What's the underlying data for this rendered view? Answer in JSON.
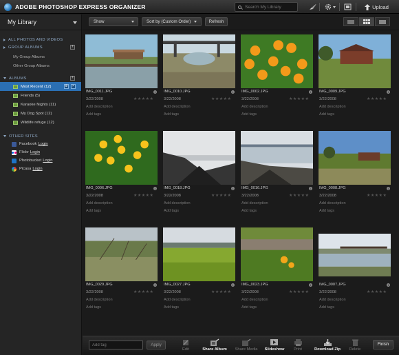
{
  "topbar": {
    "title": "ADOBE PHOTOSHOP EXPRESS ORGANIZER",
    "search_placeholder": "Search My Library",
    "upload_label": "Upload"
  },
  "sidebar": {
    "title": "My Library",
    "all_photos": "ALL PHOTOS AND VIDEOS",
    "group_albums": {
      "header": "GROUP ALBUMS",
      "items": [
        "My Group Albums",
        "Other Group Albums"
      ]
    },
    "albums": {
      "header": "ALBUMS",
      "items": [
        {
          "label": "Most Recent (12)",
          "selected": true
        },
        {
          "label": "Friends (5)",
          "selected": false
        },
        {
          "label": "Karaoke Nights (11)",
          "selected": false
        },
        {
          "label": "My Dog Spot (12)",
          "selected": false
        },
        {
          "label": "Wildlife refuge (12)",
          "selected": false
        }
      ]
    },
    "other_sites": {
      "header": "OTHER SITES",
      "items": [
        {
          "name": "Facebook",
          "action": "Login",
          "color": "#3b5998"
        },
        {
          "name": "Flickr",
          "action": "Login",
          "color": "#ff0084"
        },
        {
          "name": "Photobucket",
          "action": "Login",
          "color": "#1e74c7"
        },
        {
          "name": "Picasa",
          "action": "Login",
          "color": "#c94a3a"
        }
      ]
    }
  },
  "toolbar": {
    "show_label": "Show",
    "sort_label": "Sort by (Custom Order)",
    "refresh_label": "Refresh"
  },
  "photos": [
    {
      "file": "IMG_0011.JPG",
      "date": "3/22/2008",
      "desc": "Add description",
      "tags": "Add tags",
      "scene": "pier"
    },
    {
      "file": "IMG_0010.JPG",
      "date": "3/22/2008",
      "desc": "Add description",
      "tags": "Add tags",
      "scene": "bridge"
    },
    {
      "file": "IMG_0002.JPG",
      "date": "3/22/2008",
      "desc": "Add description",
      "tags": "Add tags",
      "scene": "poppies"
    },
    {
      "file": "IMG_0009.JPG",
      "date": "3/22/2008",
      "desc": "Add description",
      "tags": "Add tags",
      "scene": "barn"
    },
    {
      "file": "IMG_0006.JPG",
      "date": "3/22/2008",
      "desc": "Add description",
      "tags": "Add tags",
      "scene": "yellowflowers"
    },
    {
      "file": "IMG_0018.JPG",
      "date": "3/22/2008",
      "desc": "Add description",
      "tags": "Add tags",
      "scene": "rocks"
    },
    {
      "file": "IMG_0016.JPG",
      "date": "3/22/2008",
      "desc": "Add description",
      "tags": "Add tags",
      "scene": "shore"
    },
    {
      "file": "IMG_0008.JPG",
      "date": "3/22/2008",
      "desc": "Add description",
      "tags": "Add tags",
      "scene": "field"
    },
    {
      "file": "IMG_0029.JPG",
      "date": "3/22/2008",
      "desc": "Add description",
      "tags": "Add tags",
      "scene": "shrubs"
    },
    {
      "file": "IMG_0027.JPG",
      "date": "3/22/2008",
      "desc": "Add description",
      "tags": "Add tags",
      "scene": "grass"
    },
    {
      "file": "IMG_0023.JPG",
      "date": "3/22/2008",
      "desc": "Add description",
      "tags": "Add tags",
      "scene": "path"
    },
    {
      "file": "IMG_0007.JPG",
      "date": "3/22/2008",
      "desc": "Add description",
      "tags": "Add tags",
      "scene": "marsh"
    }
  ],
  "bottombar": {
    "tag_placeholder": "Add tag",
    "apply_label": "Apply",
    "actions": [
      {
        "label": "Edit",
        "icon": "edit-icon",
        "on": false
      },
      {
        "label": "Share Album",
        "icon": "share-album-icon",
        "on": true
      },
      {
        "label": "Share Media",
        "icon": "share-media-icon",
        "on": false
      },
      {
        "label": "Slideshow",
        "icon": "slideshow-icon",
        "on": true
      },
      {
        "label": "Print",
        "icon": "print-icon",
        "on": false
      },
      {
        "label": "Download Zip",
        "icon": "download-zip-icon",
        "on": true
      },
      {
        "label": "Delete",
        "icon": "trash-icon",
        "on": false
      }
    ],
    "finish_label": "Finish"
  },
  "colors": {
    "accent": "#2b6fb3",
    "section_header": "#8fa9c6",
    "background": "#1b1b1b"
  }
}
